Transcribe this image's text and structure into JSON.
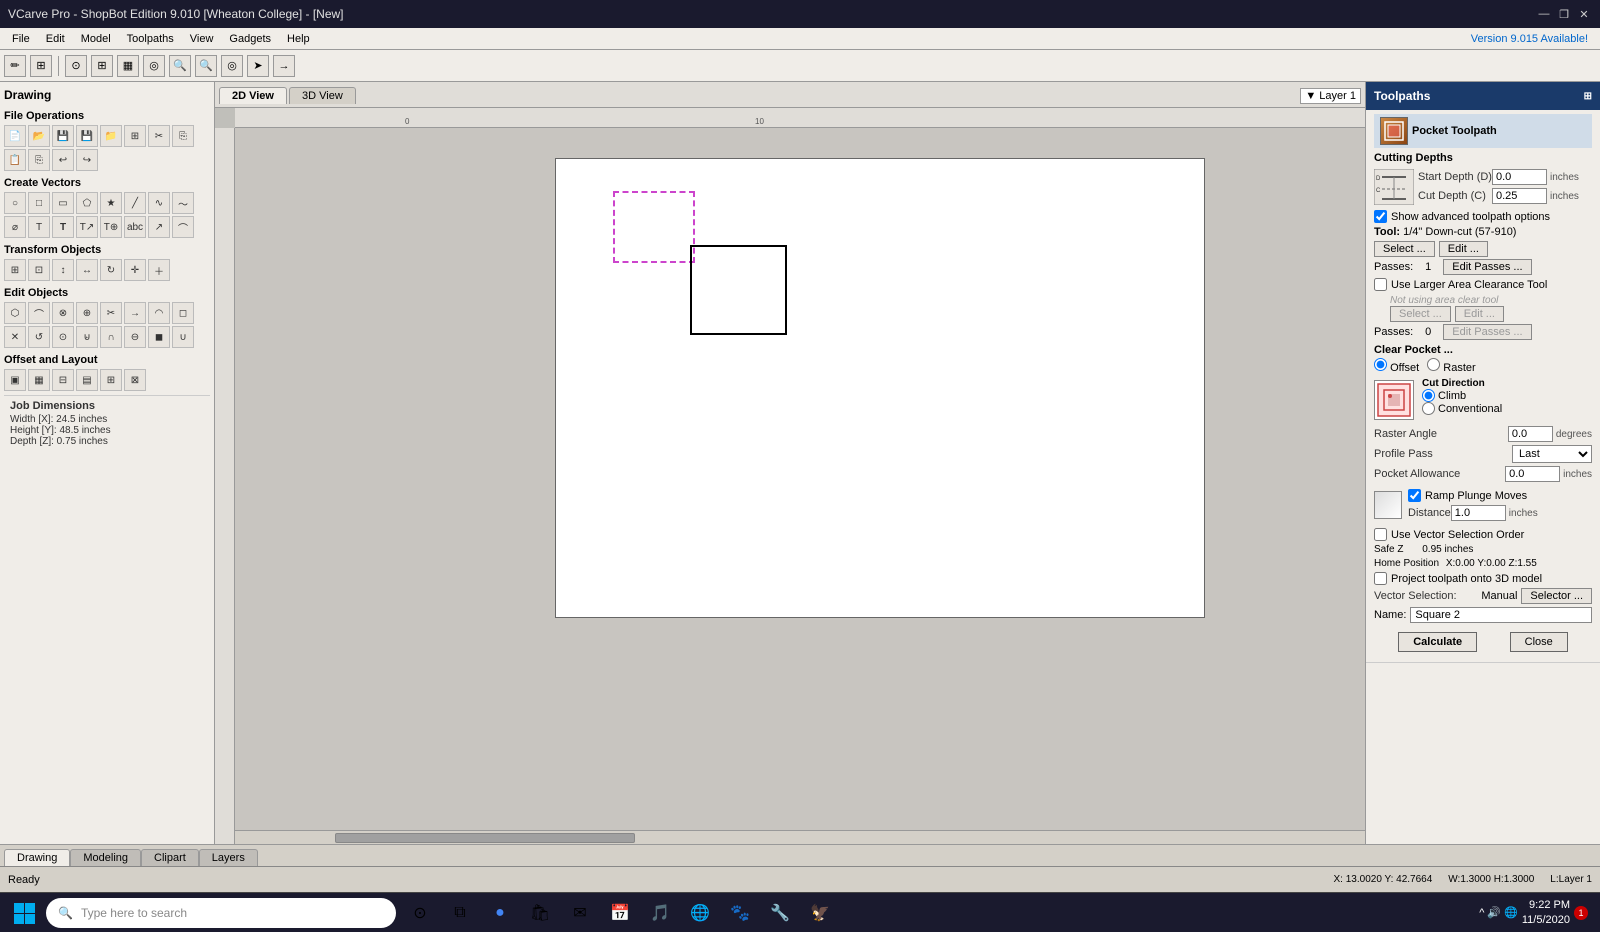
{
  "app": {
    "title": "VCarve Pro - ShopBot Edition 9.010 [Wheaton College] - [New]",
    "version_note": "Version 9.015 Available!"
  },
  "menu": {
    "items": [
      "File",
      "Edit",
      "Model",
      "Toolpaths",
      "View",
      "Gadgets",
      "Help"
    ]
  },
  "view_tabs": {
    "tabs": [
      "2D View",
      "3D View"
    ],
    "active": "2D View",
    "layer": "Layer 1"
  },
  "left_panel": {
    "title": "Drawing",
    "sections": [
      {
        "name": "File Operations",
        "tools": [
          "new",
          "open",
          "save",
          "save-as",
          "open-folder",
          "⊞",
          "cut",
          "copy",
          "paste",
          "copy2",
          "undo",
          "redo"
        ]
      },
      {
        "name": "Create Vectors",
        "tools": [
          "circle",
          "rect",
          "rect2",
          "pentagon",
          "star",
          "line",
          "curve",
          "wavy",
          "spiral",
          "T",
          "T-bold",
          "Tpath",
          "T3",
          "abc",
          "arrow",
          "curve2"
        ]
      },
      {
        "name": "Transform Objects",
        "tools": [
          "group",
          "ungroup",
          "stretch",
          "shrink",
          "rotate",
          "move",
          "add"
        ]
      },
      {
        "name": "Edit Objects",
        "tools": [
          "node",
          "smooth",
          "break",
          "join",
          "trim",
          "extend",
          "fillet",
          "chamfer",
          "delete",
          "reverse",
          "offset",
          "weld",
          "intersect",
          "subtract",
          "boundary",
          "union"
        ]
      },
      {
        "name": "Offset and Layout",
        "tools": [
          "offset-rect",
          "grid",
          "nesting",
          "array",
          "copies",
          "align"
        ]
      }
    ]
  },
  "canvas": {
    "ruler_marks": [
      "0",
      "10"
    ],
    "drawing_note": "Two rectangles: small dashed, large solid"
  },
  "right_panel": {
    "header": "Toolpaths",
    "pocket_toolpath": {
      "title": "Pocket Toolpath",
      "cutting_depths": {
        "label": "Cutting Depths",
        "start_depth_label": "Start Depth (D)",
        "start_depth_value": "0.0",
        "cut_depth_label": "Cut Depth (C)",
        "cut_depth_value": "0.25",
        "unit": "inches"
      },
      "show_advanced": {
        "label": "Show advanced toolpath options",
        "checked": true
      },
      "tool": {
        "label": "Tool:",
        "value": "1/4\"  Down-cut (57-910)",
        "select_btn": "Select ...",
        "edit_btn": "Edit ..."
      },
      "passes": {
        "label": "Passes:",
        "value": "1",
        "edit_btn": "Edit Passes ..."
      },
      "use_larger_area": {
        "label": "Use Larger Area Clearance Tool",
        "checked": false,
        "not_using_label": "Not using area clear tool",
        "select_btn": "Select ...",
        "edit_btn": "Edit ..."
      },
      "area_passes": {
        "label": "Passes:",
        "value": "0",
        "edit_btn": "Edit Passes ..."
      },
      "clear_pocket": {
        "label": "Clear Pocket ...",
        "offset_label": "Offset",
        "raster_label": "Raster",
        "selected": "Offset",
        "cut_direction_label": "Cut Direction",
        "climb_label": "Climb",
        "conventional_label": "Conventional",
        "selected_direction": "Climb",
        "raster_angle_label": "Raster Angle",
        "raster_angle_value": "0.0",
        "raster_angle_unit": "degrees",
        "profile_pass_label": "Profile Pass",
        "profile_pass_value": "Last"
      },
      "pocket_allowance": {
        "label": "Pocket Allowance",
        "value": "0.0",
        "unit": "inches"
      },
      "ramp": {
        "label": "Ramp Plunge Moves",
        "checked": true,
        "distance_label": "Distance",
        "distance_value": "1.0",
        "distance_unit": "inches"
      },
      "vector_selection_order": {
        "label": "Use Vector Selection Order",
        "checked": false
      },
      "safe_z": {
        "label": "Safe Z",
        "value": "0.95 inches"
      },
      "home_position": {
        "label": "Home Position",
        "value": "X:0.00 Y:0.00 Z:1.55"
      },
      "project_toolpath": {
        "label": "Project toolpath onto 3D model",
        "checked": false
      },
      "vector_selection": {
        "label": "Vector Selection:",
        "value": "Manual",
        "selector_btn": "Selector ..."
      },
      "name": {
        "label": "Name:",
        "value": "Square 2"
      },
      "calculate_btn": "Calculate",
      "close_btn": "Close"
    }
  },
  "bottom_tabs": {
    "tabs": [
      "Drawing",
      "Modeling",
      "Clipart",
      "Layers"
    ],
    "active": "Drawing"
  },
  "status_bar": {
    "status": "Ready",
    "coordinates": "X: 13.0020 Y: 42.7664",
    "dimensions": "W:1.3000  H:1.3000",
    "layer": "L:Layer 1"
  },
  "taskbar": {
    "search_placeholder": "Type here to search",
    "time": "9:22 PM",
    "date": "11/5/2020",
    "notification": "1"
  }
}
